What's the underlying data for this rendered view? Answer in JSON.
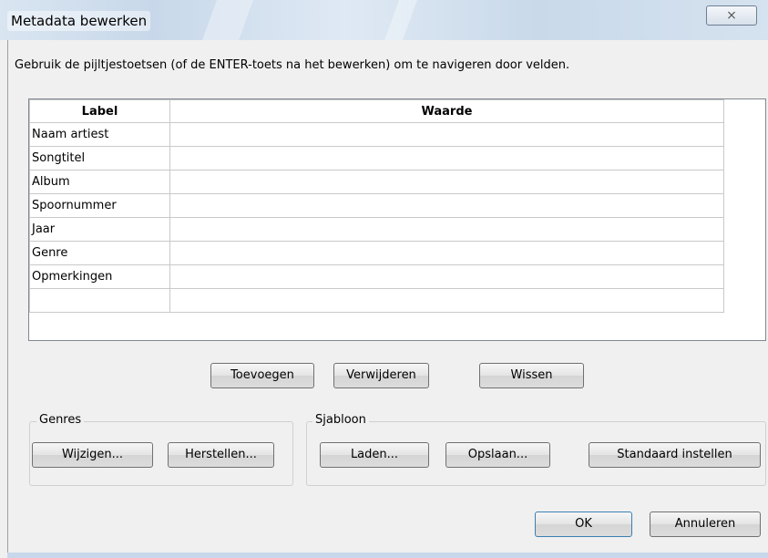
{
  "window": {
    "title": "Metadata bewerken",
    "close_glyph": "⨯"
  },
  "hint": "Gebruik de pijltjestoetsen (of de ENTER-toets na het bewerken) om te navigeren door velden.",
  "grid": {
    "headers": [
      "Label",
      "Waarde"
    ],
    "rows": [
      {
        "label": "Naam artiest",
        "value": ""
      },
      {
        "label": "Songtitel",
        "value": ""
      },
      {
        "label": "Album",
        "value": ""
      },
      {
        "label": "Spoornummer",
        "value": ""
      },
      {
        "label": "Jaar",
        "value": ""
      },
      {
        "label": "Genre",
        "value": ""
      },
      {
        "label": "Opmerkingen",
        "value": ""
      },
      {
        "label": "",
        "value": ""
      }
    ]
  },
  "row_buttons": {
    "add": "Toevoegen",
    "remove": "Verwijderen",
    "clear": "Wissen"
  },
  "genres": {
    "legend": "Genres",
    "edit": "Wijzigen...",
    "reset": "Herstellen..."
  },
  "template": {
    "legend": "Sjabloon",
    "load": "Laden...",
    "save": "Opslaan...",
    "set_default": "Standaard instellen"
  },
  "dialog": {
    "ok": "OK",
    "cancel": "Annuleren"
  },
  "icons": {
    "close": "close-icon"
  }
}
